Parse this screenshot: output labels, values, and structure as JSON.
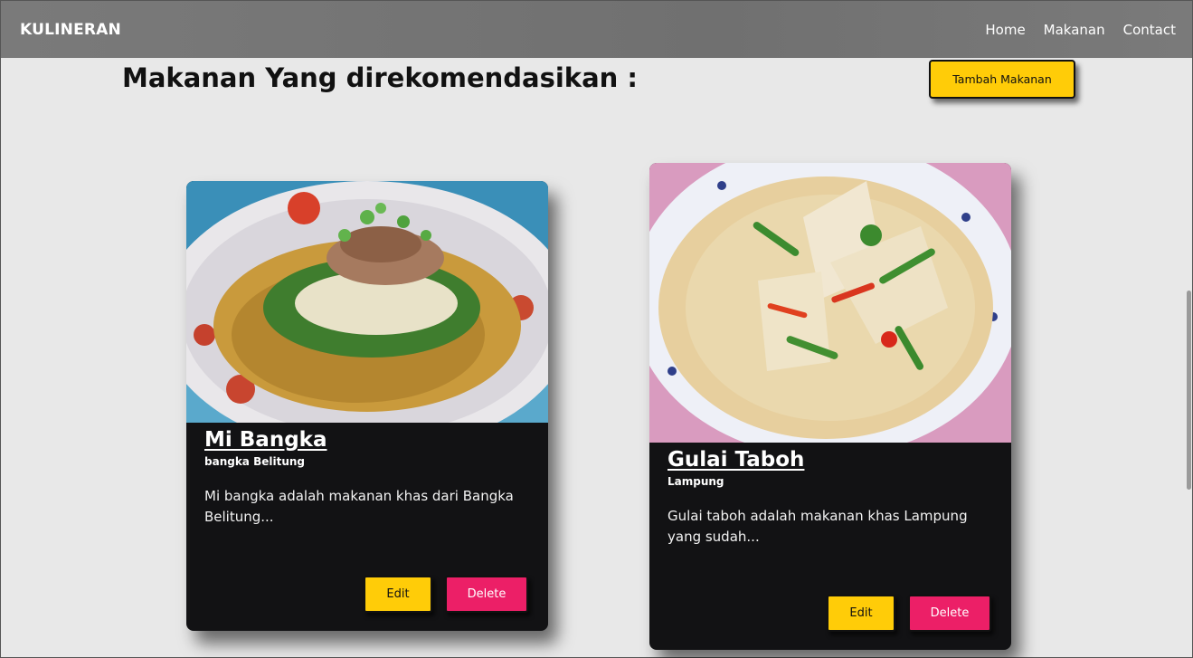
{
  "nav": {
    "brand": "KULINERAN",
    "links": [
      "Home",
      "Makanan",
      "Contact"
    ]
  },
  "main": {
    "title": "Makanan Yang direkomendasikan :",
    "add_button": "Tambah Makanan"
  },
  "cards": [
    {
      "title": "Mi Bangka",
      "region": "bangka Belitung",
      "description": "Mi bangka adalah makanan khas dari Bangka Belitung...",
      "edit": "Edit",
      "delete": "Delete"
    },
    {
      "title": "Gulai Taboh",
      "region": "Lampung",
      "description": "Gulai taboh adalah makanan khas Lampung yang sudah...",
      "edit": "Edit",
      "delete": "Delete"
    }
  ],
  "colors": {
    "accent_yellow": "#ffcc08",
    "accent_pink": "#ec1f67",
    "card_bg": "#121214",
    "nav_bg": "#737373"
  }
}
